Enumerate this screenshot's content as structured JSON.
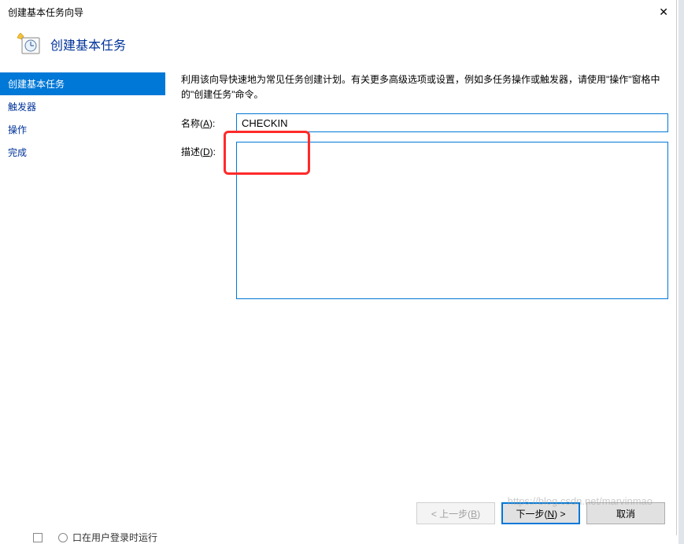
{
  "window": {
    "title": "创建基本任务向导"
  },
  "header": {
    "title": "创建基本任务"
  },
  "sidebar": {
    "items": [
      {
        "label": "创建基本任务",
        "active": true
      },
      {
        "label": "触发器",
        "active": false
      },
      {
        "label": "操作",
        "active": false
      },
      {
        "label": "完成",
        "active": false
      }
    ]
  },
  "main": {
    "description": "利用该向导快速地为常见任务创建计划。有关更多高级选项或设置，例如多任务操作或触发器，请使用\"操作\"窗格中的\"创建任务\"命令。",
    "name_label_prefix": "名称(",
    "name_label_mnemonic": "A",
    "name_label_suffix": "):",
    "name_value": "CHECKIN",
    "desc_label_prefix": "描述(",
    "desc_label_mnemonic": "D",
    "desc_label_suffix": "):",
    "desc_value": ""
  },
  "footer": {
    "back_prefix": "< 上一步(",
    "back_mnemonic": "B",
    "back_suffix": ")",
    "next_prefix": "下一步(",
    "next_mnemonic": "N",
    "next_suffix": ") >",
    "cancel": "取消"
  },
  "watermark": "https://blog.csdn.net/marvinmao",
  "bottom_clip": "口在用户登录时运行"
}
